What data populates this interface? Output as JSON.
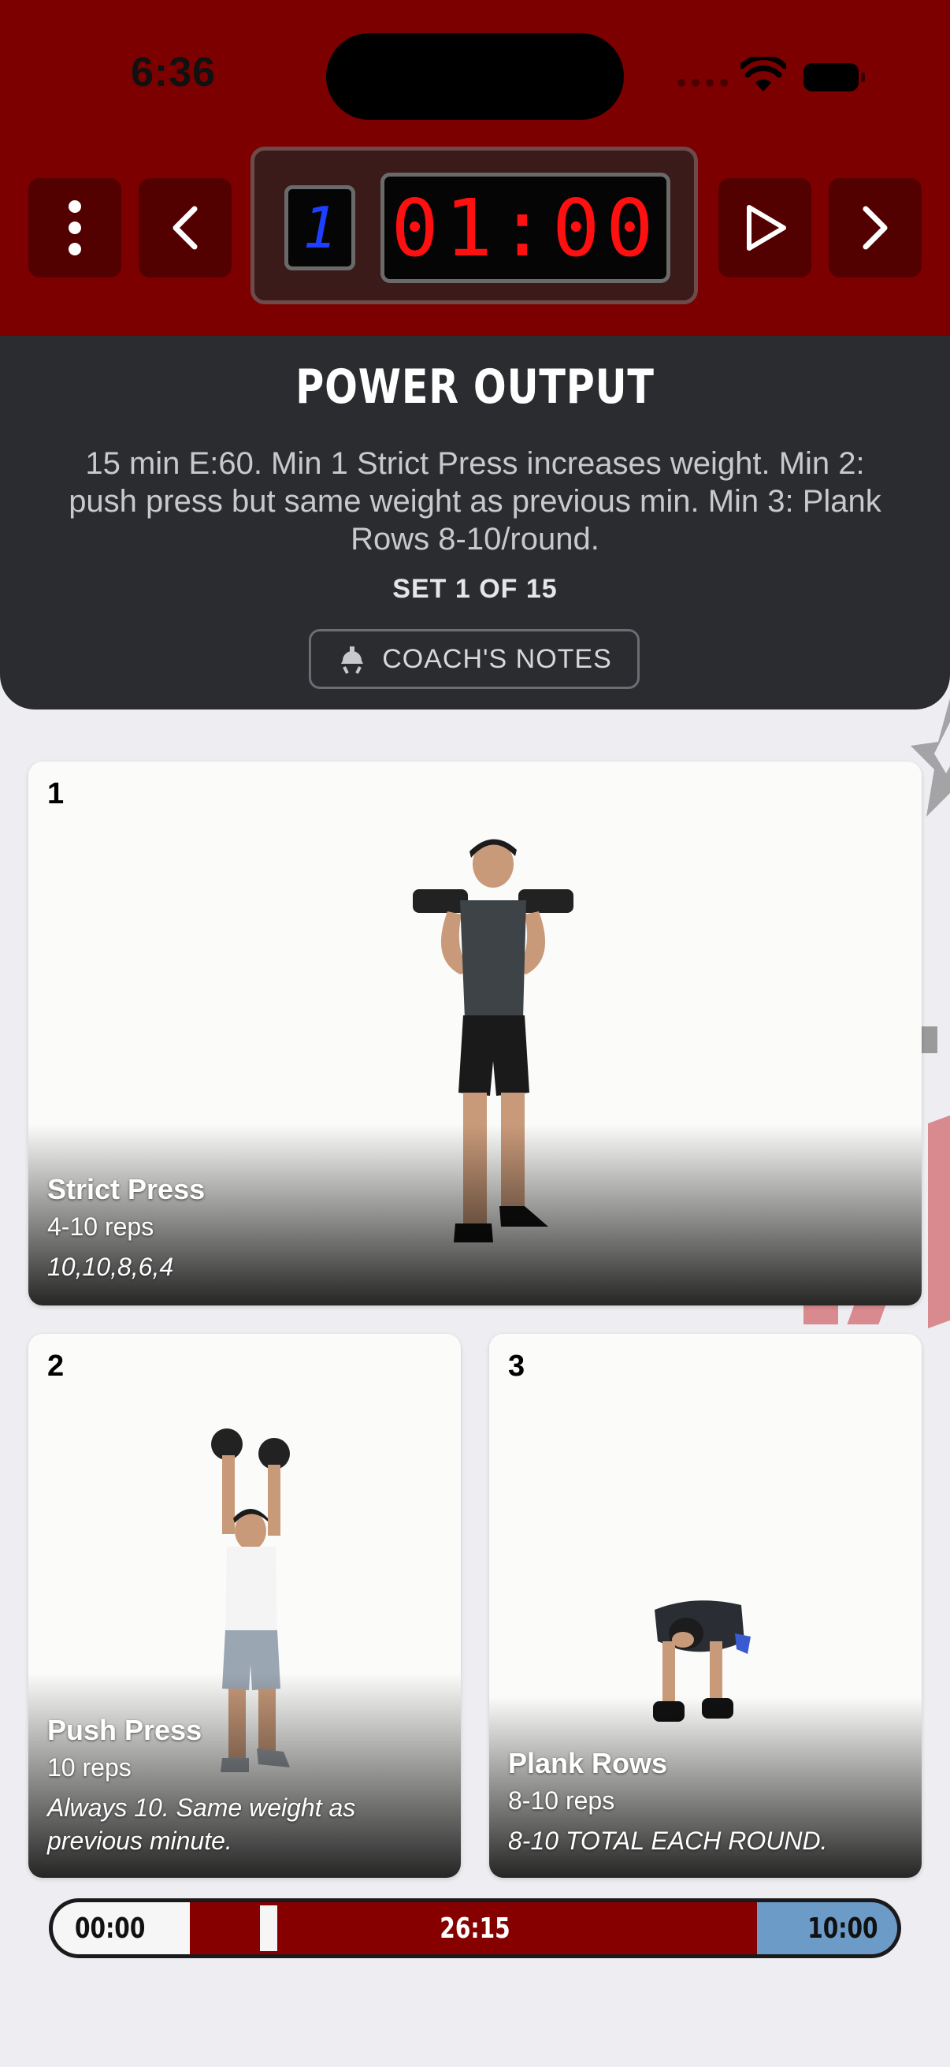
{
  "status_bar": {
    "time": "6:36"
  },
  "timer": {
    "round_digit": "1",
    "clock": "01:00"
  },
  "workout": {
    "title": "POWER OUTPUT",
    "description": "15 min E:60. Min 1 Strict Press increases weight. Min 2: push press but same weight as previous min. Min 3: Plank Rows 8-10/round.",
    "set_label": "SET 1 OF 15",
    "notes_button": "COACH'S NOTES"
  },
  "exercises": [
    {
      "number": "1",
      "name": "Strict Press",
      "reps": "4-10 reps",
      "note": "10,10,8,6,4"
    },
    {
      "number": "2",
      "name": "Push Press",
      "reps": "10 reps",
      "note": "Always 10. Same weight as previous minute."
    },
    {
      "number": "3",
      "name": "Plank Rows",
      "reps": "8-10 reps",
      "note": "8-10 TOTAL EACH ROUND."
    }
  ],
  "progress": {
    "start_label": "00:00",
    "middle_label": "26:15",
    "end_label": "10:00",
    "marker_fraction": 0.245
  },
  "icons": [
    "menu-dots-icon",
    "chevron-left-icon",
    "play-icon",
    "chevron-right-icon",
    "wifi-icon",
    "battery-icon",
    "coach-whistle-icon"
  ],
  "colors": {
    "header_red": "#7c0000",
    "button_dark_red": "#530000",
    "panel_dark": "#2a2c30",
    "digit_red": "#ff1010",
    "round_blue": "#1d3fff",
    "progress_red": "#870000",
    "progress_blue": "#6d9bc8"
  }
}
